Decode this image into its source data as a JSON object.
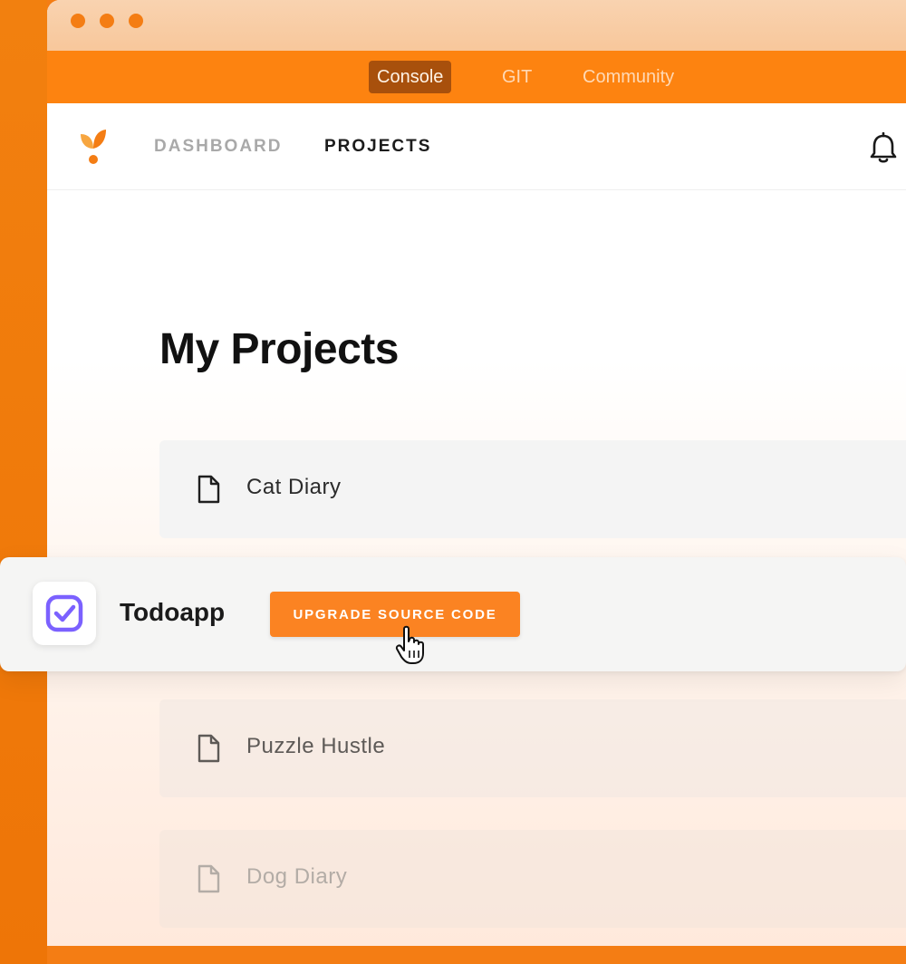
{
  "window": {
    "traffic_lights": [
      "close-dot",
      "minimize-dot",
      "maximize-dot"
    ]
  },
  "top_tabs": [
    {
      "label": "Console",
      "active": true
    },
    {
      "label": "GIT",
      "active": false
    },
    {
      "label": "Community",
      "active": false
    }
  ],
  "navbar": {
    "logo_icon": "leaf-logo-icon",
    "links": [
      {
        "label": "DASHBOARD",
        "active": false
      },
      {
        "label": "PROJECTS",
        "active": true
      }
    ],
    "notification_icon": "bell-icon"
  },
  "main": {
    "title": "My Projects",
    "projects": [
      {
        "name": "Cat Diary",
        "icon": "file-icon"
      },
      {
        "name": "Puzzle Hustle",
        "icon": "file-icon"
      },
      {
        "name": "Dog Diary",
        "icon": "file-icon"
      }
    ]
  },
  "highlight_card": {
    "app_name": "Todoapp",
    "app_icon": "checkbox-icon",
    "button_label": "UPGRADE SOURCE CODE"
  },
  "colors": {
    "brand_orange": "#fd8310",
    "button_orange": "#fb8322",
    "active_tab_bg": "#a8500c",
    "app_icon_purple": "#7b61ff"
  }
}
